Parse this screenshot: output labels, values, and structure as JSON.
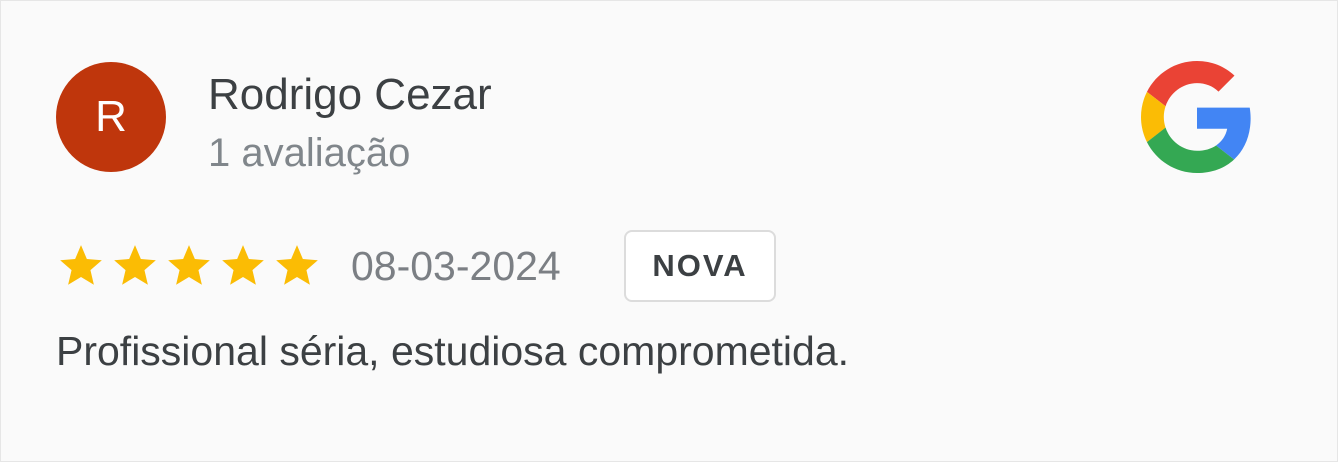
{
  "review": {
    "reviewer": {
      "initial": "R",
      "name": "Rodrigo Cezar",
      "review_count": "1 avaliação",
      "avatar_color": "#bf360c"
    },
    "rating": 5,
    "rating_max": 5,
    "date": "08-03-2024",
    "badge": "NOVA",
    "text": "Profissional séria, estudiosa comprometida.",
    "source_icon": "google-g-icon",
    "star_icon": "star-icon",
    "star_color": "#fbbc04"
  }
}
